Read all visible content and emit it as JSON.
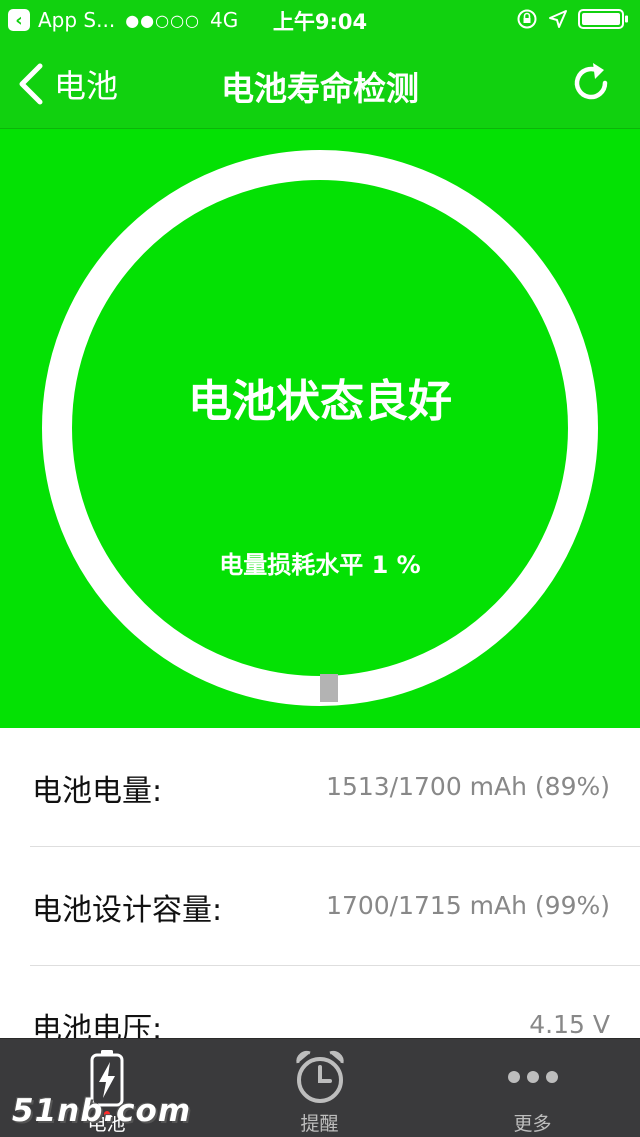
{
  "status_bar": {
    "back_app": "App S...",
    "signal_dots": "●●○○○",
    "network": "4G",
    "time": "上午9:04"
  },
  "nav": {
    "back_label": "电池",
    "title": "电池寿命检测"
  },
  "hero": {
    "status": "电池状态良好",
    "loss": "电量损耗水平 1 %",
    "loss_percent": 1
  },
  "rows": [
    {
      "label": "电池电量:",
      "value": "1513/1700 mAh (89%)"
    },
    {
      "label": "电池设计容量:",
      "value": "1700/1715 mAh (99%)"
    },
    {
      "label": "电池电压:",
      "value": "4.15 V"
    }
  ],
  "tabs": [
    {
      "label": "电池",
      "icon": "battery-bolt-icon",
      "active": true
    },
    {
      "label": "提醒",
      "icon": "alarm-clock-icon",
      "active": false
    },
    {
      "label": "更多",
      "icon": "more-dots-icon",
      "active": false
    }
  ],
  "watermark": "51nb.com",
  "colors": {
    "nav_green": "#11d10f",
    "hero_green": "#04e104",
    "tab_bar": "#3a3a3c"
  }
}
